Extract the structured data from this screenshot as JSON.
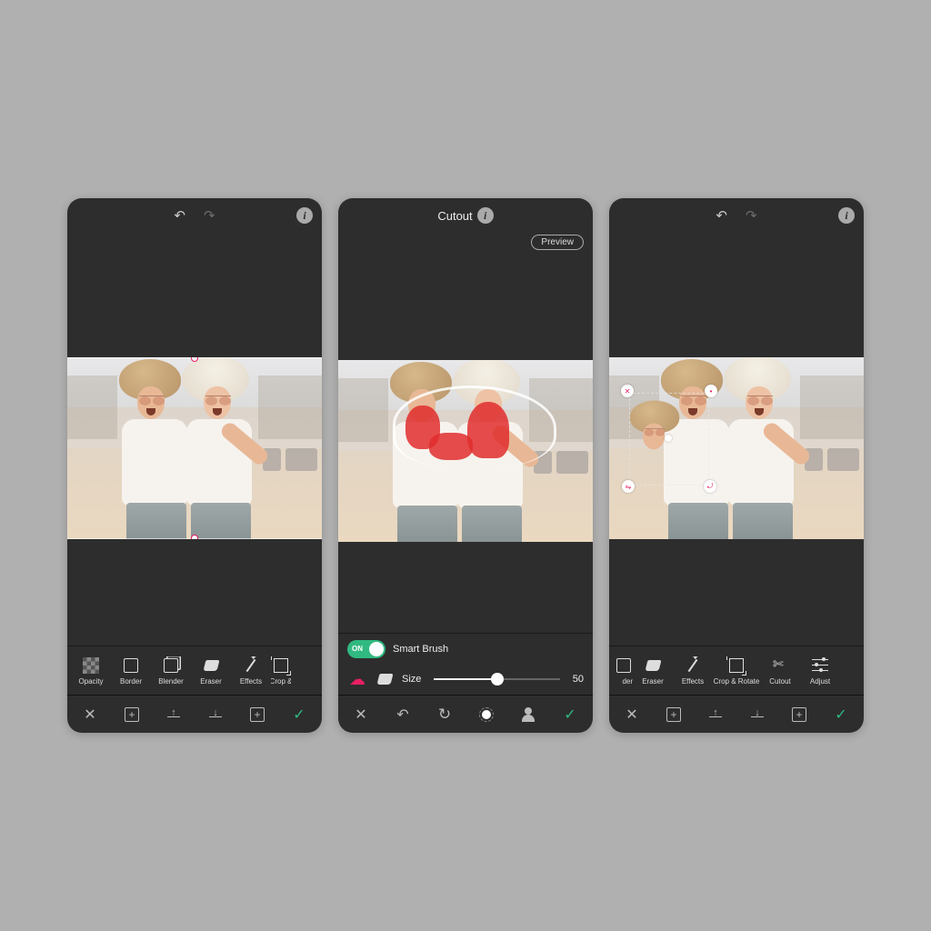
{
  "screens": {
    "s1": {
      "tools": [
        {
          "id": "opacity",
          "label": "Opacity"
        },
        {
          "id": "border",
          "label": "Border"
        },
        {
          "id": "blender",
          "label": "Blender"
        },
        {
          "id": "eraser",
          "label": "Eraser"
        },
        {
          "id": "effects",
          "label": "Effects"
        },
        {
          "id": "crop",
          "label": "Crop &"
        }
      ]
    },
    "s2": {
      "title": "Cutout",
      "preview": "Preview",
      "smartbrush_toggle": "ON",
      "smartbrush_label": "Smart Brush",
      "size_label": "Size",
      "size_value": "50"
    },
    "s3": {
      "tools_left": {
        "id": "der",
        "label": "der"
      },
      "tools": [
        {
          "id": "eraser",
          "label": "Eraser"
        },
        {
          "id": "effects",
          "label": "Effects"
        },
        {
          "id": "crop",
          "label": "Crop & Rotate"
        },
        {
          "id": "cutout",
          "label": "Cutout"
        },
        {
          "id": "adjust",
          "label": "Adjust"
        }
      ]
    }
  }
}
